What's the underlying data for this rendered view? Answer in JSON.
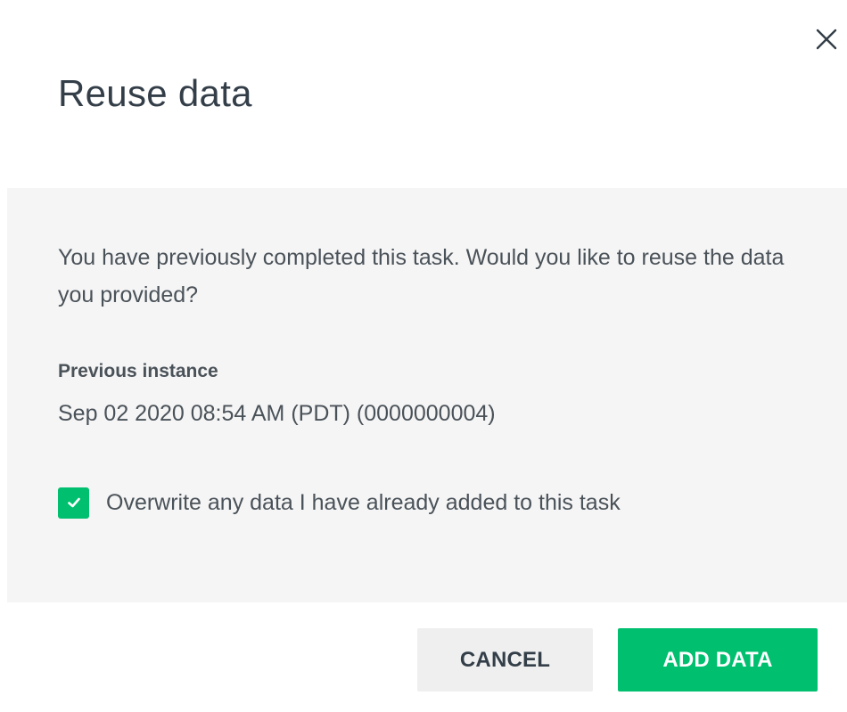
{
  "dialog": {
    "title": "Reuse data",
    "close_icon": "close-icon"
  },
  "body": {
    "message": "You have previously completed this task. Would you like to reuse the data you provided?",
    "previous_instance_label": "Previous instance",
    "previous_instance_value": "Sep 02 2020 08:54 AM (PDT) (0000000004)",
    "overwrite_checkbox": {
      "label": "Overwrite any data I have already added to this task",
      "checked": true,
      "icon": "checkmark-icon"
    }
  },
  "footer": {
    "cancel_label": "CANCEL",
    "add_data_label": "ADD DATA"
  },
  "colors": {
    "accent": "#00bf6f",
    "panel_background": "#f5f5f5",
    "cancel_background": "#efefef",
    "text": "#333e48"
  }
}
